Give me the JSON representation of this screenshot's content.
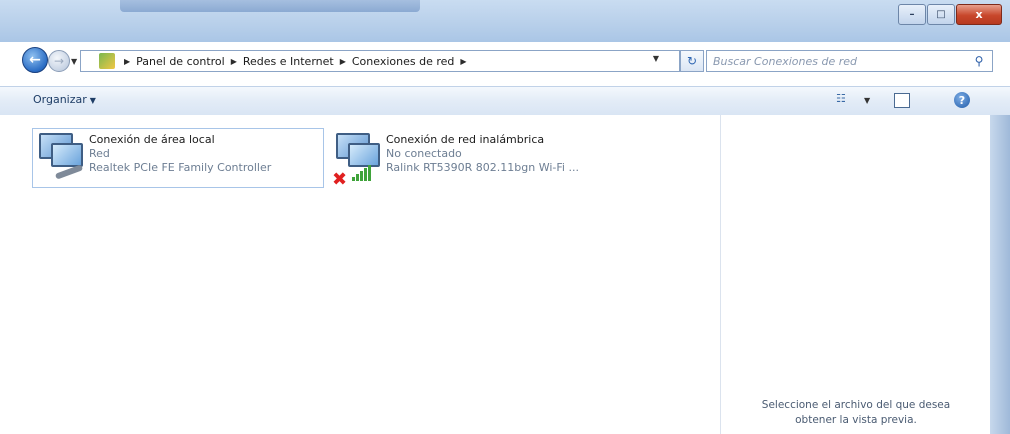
{
  "window": {
    "close_glyph": "x",
    "minimize_glyph": "–",
    "maximize_glyph": "□"
  },
  "nav": {
    "breadcrumbs": [
      "Panel de control",
      "Redes e Internet",
      "Conexiones de red"
    ],
    "search_placeholder": "Buscar Conexiones de red"
  },
  "toolbar": {
    "organize_label": "Organizar"
  },
  "connections": [
    {
      "name": "Conexión de área local",
      "status": "Red",
      "device": "Realtek PCIe FE Family Controller",
      "icon": "wired-network-icon"
    },
    {
      "name": "Conexión de red inalámbrica",
      "status": "No conectado",
      "device": "Ralink RT5390R 802.11bgn Wi-Fi ...",
      "icon": "wireless-network-icon"
    }
  ],
  "preview": {
    "line1": "Seleccione el archivo del que desea",
    "line2": "obtener la vista previa."
  }
}
